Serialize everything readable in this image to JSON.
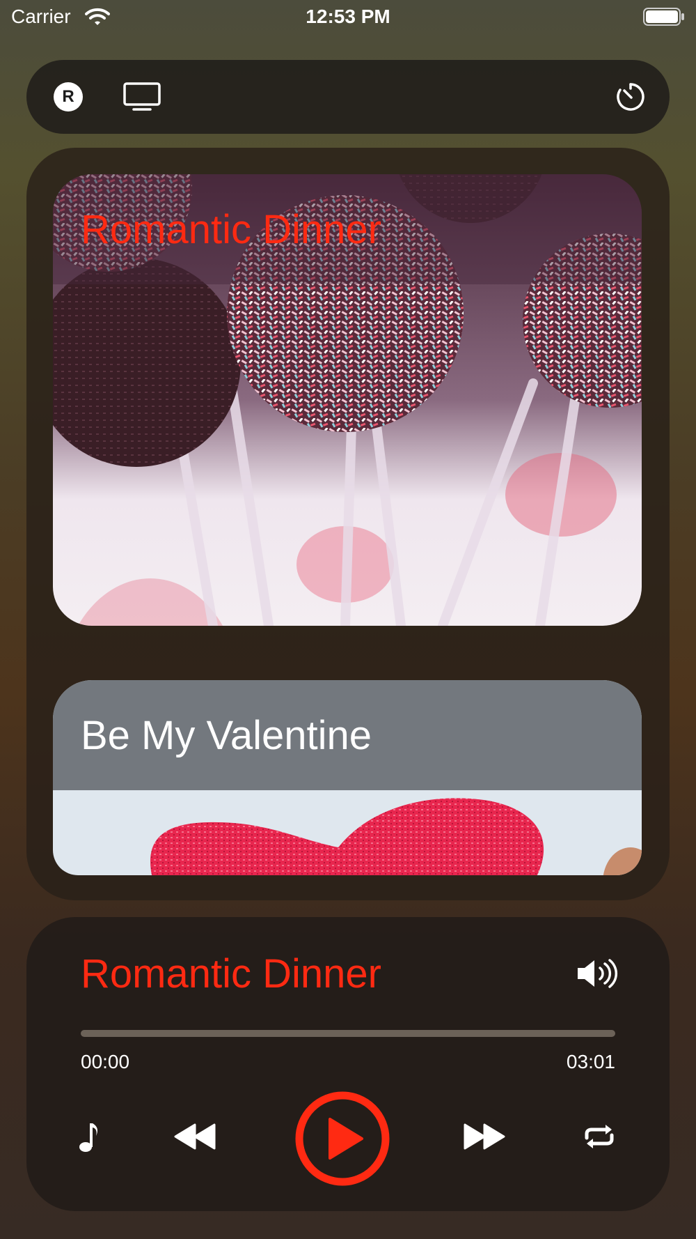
{
  "status_bar": {
    "carrier": "Carrier",
    "time": "12:53 PM",
    "icons": [
      "wifi-icon",
      "battery-icon"
    ]
  },
  "toolbar": {
    "logo_letter": "R",
    "icons": [
      "r-logo-icon",
      "tv-icon",
      "timer-icon"
    ]
  },
  "playlist": {
    "items": [
      {
        "title": "Romantic Dinner",
        "title_color": "#ff2a12",
        "art": "cake-pops-image"
      },
      {
        "title": "Be My Valentine",
        "title_color": "#ffffff",
        "art": "heart-drawing-image"
      }
    ]
  },
  "player": {
    "title": "Romantic Dinner",
    "time_elapsed": "00:00",
    "time_total": "03:01",
    "progress": 0,
    "icons": [
      "volume-icon",
      "music-note-icon",
      "rewind-icon",
      "play-icon",
      "fast-forward-icon",
      "repeat-icon"
    ]
  },
  "colors": {
    "accent": "#ff2a12",
    "panel": "#2a231d",
    "text": "#ffffff"
  }
}
